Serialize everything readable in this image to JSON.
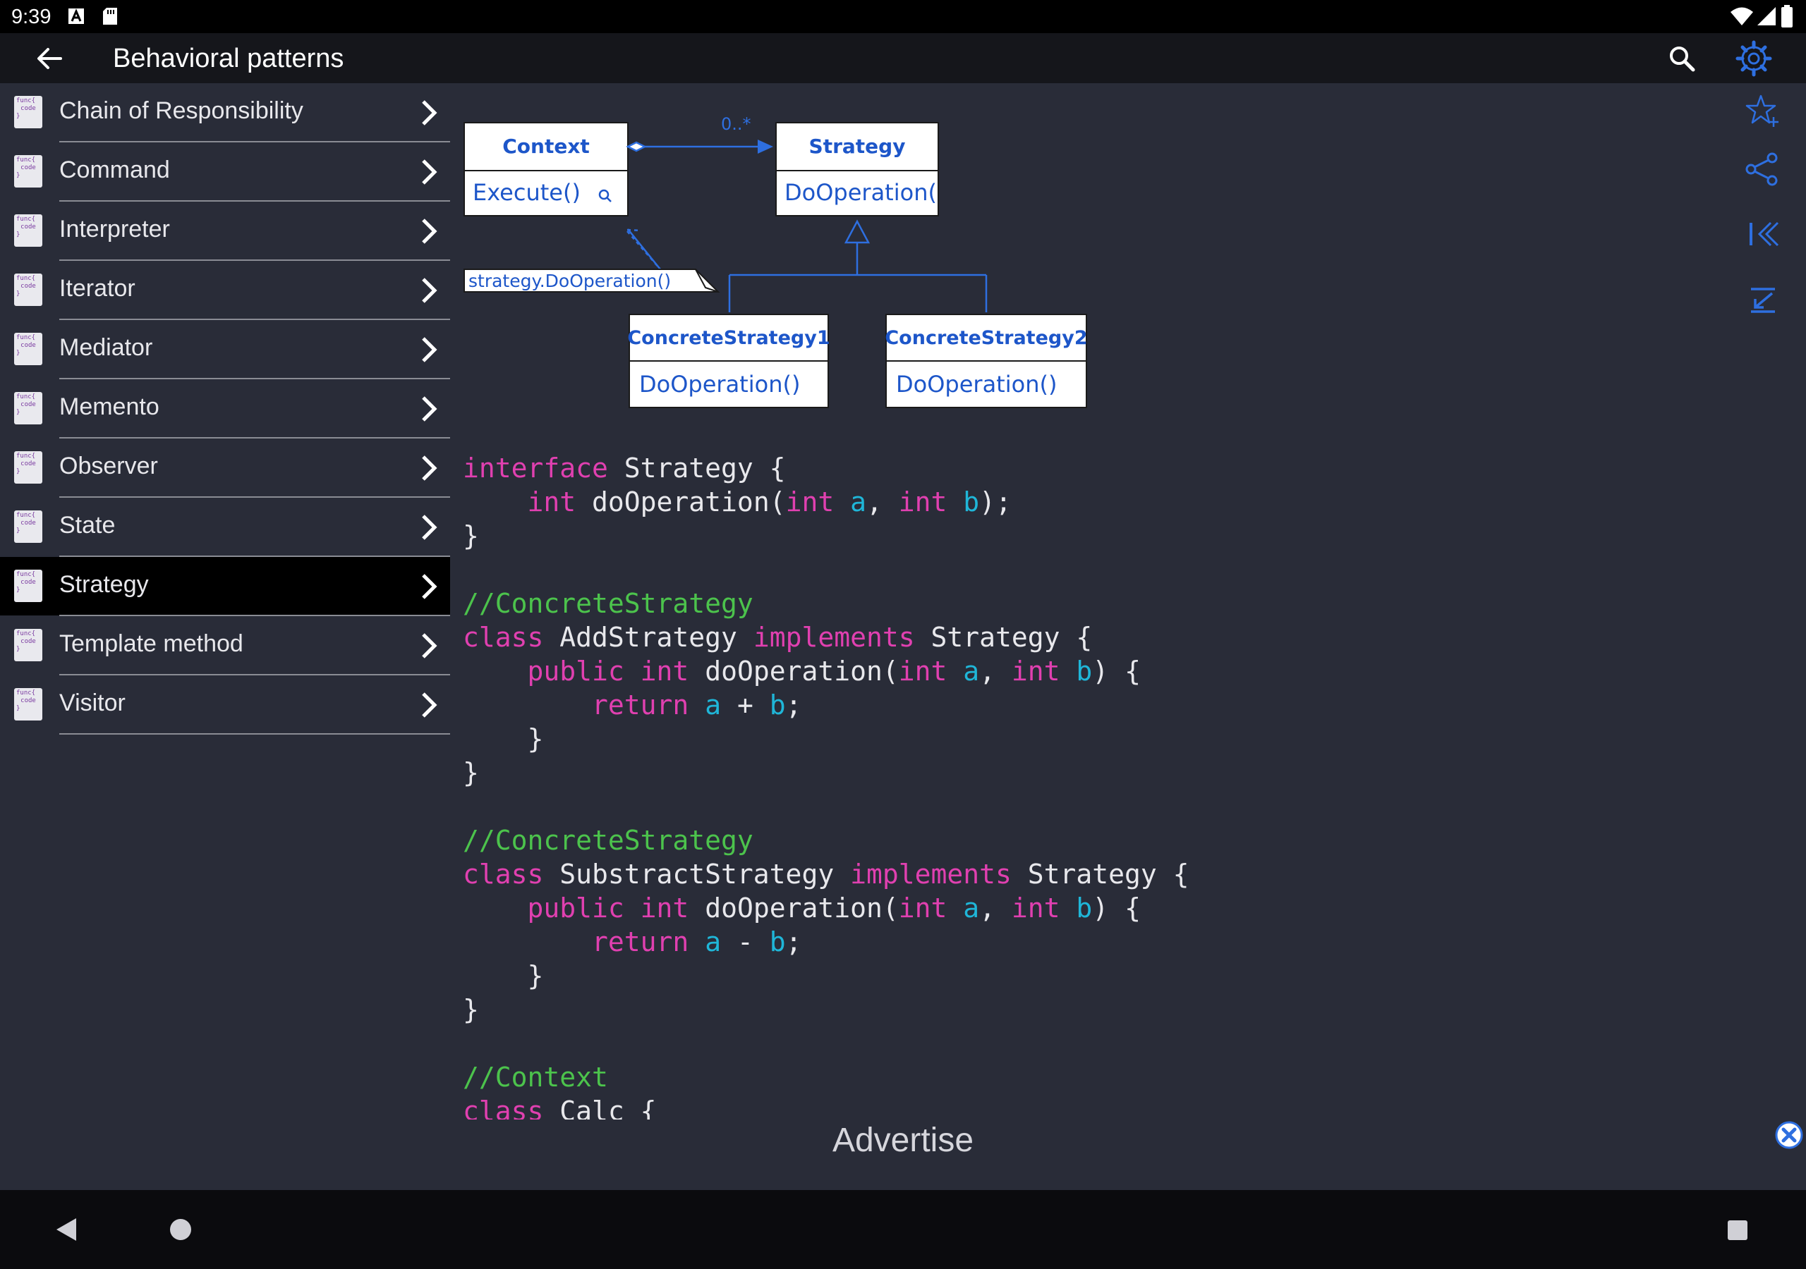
{
  "status": {
    "time": "9:39"
  },
  "header": {
    "title": "Behavioral patterns"
  },
  "sidebar": {
    "items": [
      {
        "label": "Chain of Responsibility",
        "selected": false
      },
      {
        "label": "Command",
        "selected": false
      },
      {
        "label": "Interpreter",
        "selected": false
      },
      {
        "label": "Iterator",
        "selected": false
      },
      {
        "label": "Mediator",
        "selected": false
      },
      {
        "label": "Memento",
        "selected": false
      },
      {
        "label": "Observer",
        "selected": false
      },
      {
        "label": "State",
        "selected": false
      },
      {
        "label": "Strategy",
        "selected": true
      },
      {
        "label": "Template method",
        "selected": false
      },
      {
        "label": "Visitor",
        "selected": false
      }
    ],
    "item_icon_text": [
      "func{",
      "code",
      "}"
    ]
  },
  "diagram": {
    "context": "Context",
    "execute": "Execute()",
    "strategy": "Strategy",
    "strategy_op": "DoOperation(",
    "multiplicity": "0..*",
    "note": "strategy.DoOperation()",
    "concrete1": "ConcreteStrategy1",
    "concrete2": "ConcreteStrategy2",
    "do_op": "DoOperation()"
  },
  "code": {
    "l1_kw": "interface",
    "l1_rest": " Strategy {",
    "l2_kw": "int",
    "l2_name": " doOperation(",
    "l2_t1": "int",
    "l2_a": " a",
    "l2_sep": ", ",
    "l2_t2": "int",
    "l2_b": " b",
    "l2_end": ");",
    "close": "}",
    "comment1": "//ConcreteStrategy",
    "c1_kw": "class",
    "c1_name": " AddStrategy ",
    "c1_impl": "implements",
    "c1_rest": " Strategy {",
    "m_pub": "public",
    "m_int": " int",
    "m_name": " doOperation(",
    "m_t1": "int",
    "m_a": " a",
    "m_sep": ", ",
    "m_t2": "int",
    "m_b": " b",
    "m_end": ") {",
    "r_kw": "return",
    "r_a": " a",
    "r_plus": " + ",
    "r_b": "b",
    "r_semi": ";",
    "comment2": "//ConcreteStrategy",
    "c2_kw": "class",
    "c2_name": " SubstractStrategy ",
    "c2_impl": "implements",
    "c2_rest": " Strategy {",
    "r2_minus": " - ",
    "comment3": "//Context",
    "c3_kw": "class",
    "c3_rest": " Calc {"
  },
  "ad": {
    "label": "Advertise"
  },
  "colors": {
    "accent": "#2e6fe0",
    "keyword": "#e040b0",
    "variable": "#1fb6d8",
    "comment": "#4cc34c",
    "background": "#292c38"
  },
  "icons": [
    "back-arrow-icon",
    "search-icon",
    "gear-icon",
    "star-icon",
    "share-icon",
    "first-page-icon",
    "scroll-bottom-icon",
    "close-icon"
  ]
}
